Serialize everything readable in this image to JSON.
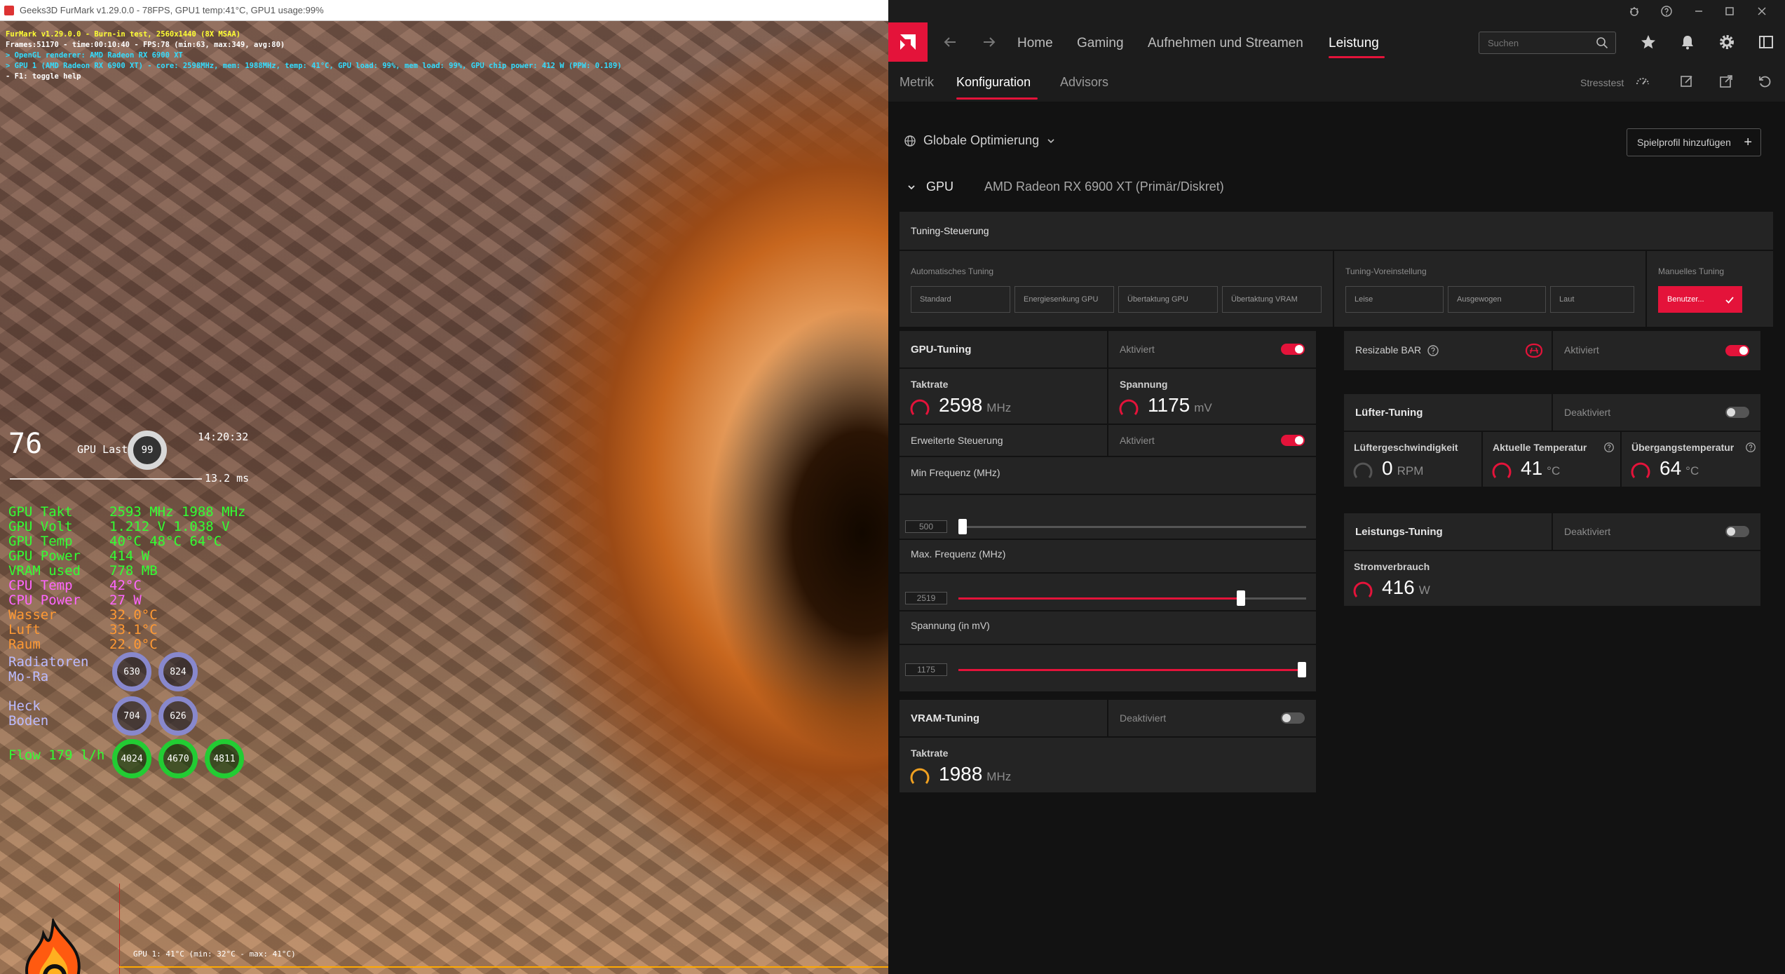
{
  "furmark": {
    "title": "Geeks3D FurMark v1.29.0.0 - 78FPS, GPU1 temp:41°C, GPU1 usage:99%",
    "info_lines": [
      "FurMark v1.29.0.0 - Burn-in test, 2560x1440 (8X MSAA)",
      "Frames:51170 - time:00:10:40 - FPS:78 (min:63, max:349, avg:80)",
      "> OpenGL renderer: AMD Radeon RX 6900 XT",
      "> GPU 1 (AMD Radeon RX 6900 XT) - core: 2598MHz, mem: 1988MHz, temp: 41°C, GPU load: 99%, mem load: 99%, GPU chip power: 412 W (PPW: 0.189)",
      "- F1: toggle help"
    ],
    "graph_label": "GPU 1: 41°C (min: 32°C - max: 41°C)"
  },
  "osd": {
    "fps": "76",
    "gpu_last_label": "GPU Last",
    "gpu_last_value": "99",
    "clock": "14:20:32",
    "frametime": "13.2 ms",
    "rows": [
      {
        "label": "GPU Takt",
        "value": "2593 MHz 1988 MHz",
        "color": "#33ff33"
      },
      {
        "label": "GPU Volt",
        "value": "1.212 V  1.038 V",
        "color": "#33ff33"
      },
      {
        "label": "GPU Temp",
        "value": "40°C  48°C  64°C",
        "color": "#33ff33"
      },
      {
        "label": "GPU Power",
        "value": "414 W",
        "color": "#33ff33"
      },
      {
        "label": "VRAM used",
        "value": "778 MB",
        "color": "#33ff33"
      },
      {
        "label": "CPU Temp",
        "value": "42°C",
        "color": "#ff66ff"
      },
      {
        "label": "CPU Power",
        "value": "27 W",
        "color": "#ff66ff"
      },
      {
        "label": "Wasser",
        "value": "32.0°C",
        "color": "#ff9933"
      },
      {
        "label": "Luft",
        "value": "33.1°C",
        "color": "#ff9933"
      },
      {
        "label": "Raum",
        "value": "22.0°C",
        "color": "#ff9933"
      }
    ],
    "radiatoren_label": "Radiatoren",
    "mora_label": "Mo-Ra",
    "radiatoren_values": [
      "630",
      "824"
    ],
    "heck_label": "Heck",
    "boden_label": "Boden",
    "heck_values": [
      "704",
      "626"
    ],
    "flow_label": "Flow 179 l/h",
    "flow_values": [
      "4024",
      "4670",
      "4811"
    ]
  },
  "amd": {
    "search_placeholder": "Suchen",
    "nav": {
      "home": "Home",
      "gaming": "Gaming",
      "streaming": "Aufnehmen und Streamen",
      "performance": "Leistung"
    },
    "subnav": {
      "metrics": "Metrik",
      "config": "Konfiguration",
      "advisors": "Advisors",
      "stresstest": "Stresstest"
    },
    "global_opt": "Globale Optimierung",
    "add_profile": "Spielprofil hinzufügen",
    "gpu_label": "GPU",
    "gpu_name": "AMD Radeon RX 6900 XT (Primär/Diskret)",
    "tuning": {
      "title": "Tuning-Steuerung",
      "auto_label": "Automatisches Tuning",
      "auto_buttons": [
        "Standard",
        "Energiesenkung GPU",
        "Übertaktung GPU",
        "Übertaktung VRAM"
      ],
      "preset_label": "Tuning-Voreinstellung",
      "preset_buttons": [
        "Leise",
        "Ausgewogen",
        "Laut"
      ],
      "manual_label": "Manuelles Tuning",
      "manual_button": "Benutzer..."
    },
    "gpu_tuning": {
      "title": "GPU-Tuning",
      "state": "Aktiviert",
      "clock_label": "Taktrate",
      "clock_value": "2598",
      "clock_unit": "MHz",
      "voltage_label": "Spannung",
      "voltage_value": "1175",
      "voltage_unit": "mV",
      "advanced_label": "Erweiterte Steuerung",
      "advanced_state": "Aktiviert",
      "min_freq_label": "Min Frequenz (MHz)",
      "min_freq_value": "500",
      "max_freq_label": "Max. Frequenz (MHz)",
      "max_freq_value": "2519",
      "max_freq_fraction": 0.8,
      "volt_label": "Spannung (in mV)",
      "volt_value": "1175",
      "volt_fraction": 1.0
    },
    "vram_tuning": {
      "title": "VRAM-Tuning",
      "state": "Deaktiviert",
      "clock_label": "Taktrate",
      "clock_value": "1988",
      "clock_unit": "MHz"
    },
    "resizable_bar": {
      "title": "Resizable BAR",
      "state": "Aktiviert"
    },
    "fan_tuning": {
      "title": "Lüfter-Tuning",
      "state": "Deaktiviert",
      "fan_speed_label": "Lüftergeschwindigkeit",
      "fan_speed_value": "0",
      "fan_speed_unit": "RPM",
      "temp_label": "Aktuelle Temperatur",
      "temp_value": "41",
      "temp_unit": "°C",
      "junction_label": "Übergangstemperatur",
      "junction_value": "64",
      "junction_unit": "°C"
    },
    "power_tuning": {
      "title": "Leistungs-Tuning",
      "state": "Deaktiviert",
      "power_label": "Stromverbrauch",
      "power_value": "416",
      "power_unit": "W"
    }
  }
}
